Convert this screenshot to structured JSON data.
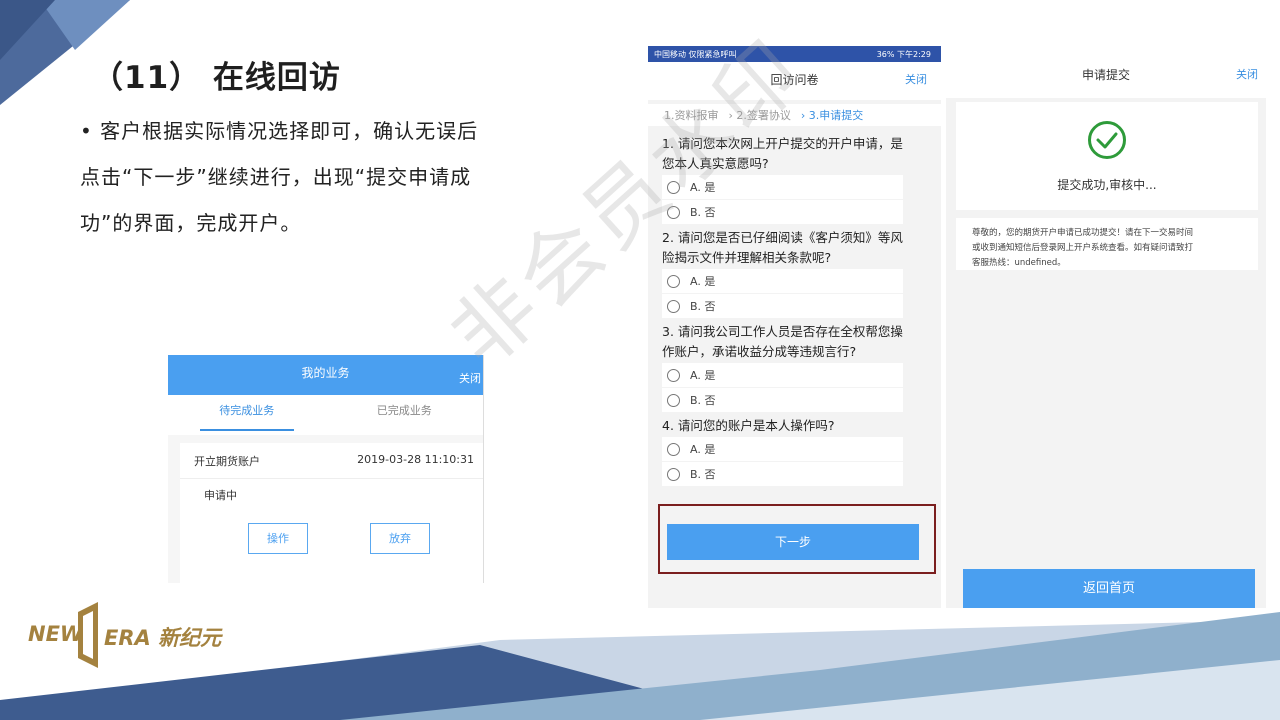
{
  "slide": {
    "title": "（11） 在线回访",
    "bullet_lines": [
      "• 客户根据实际情况选择即可，确认无误后",
      "点击“下一步”继续进行，出现“提交申请成",
      "功”的界面，完成开户。"
    ]
  },
  "logo": {
    "left": "NEW",
    "right": "ERA 新纪元"
  },
  "watermark": "非会员水印",
  "my_business": {
    "title": "我的业务",
    "close": "关闭",
    "tabs": [
      "待完成业务",
      "已完成业务"
    ],
    "item_name": "开立期货账户",
    "item_time": "2019-03-28 11:10:31",
    "status": "申请中",
    "buttons": [
      "操作",
      "放弃"
    ]
  },
  "questionnaire": {
    "status_left": "中国移动 仅限紧急呼叫",
    "status_right": "36% 下午2:29",
    "title": "回访问卷",
    "close": "关闭",
    "steps": [
      "1.资料报审",
      "›  2.签署协议",
      "›  3.申请提交"
    ],
    "questions": [
      {
        "text_lines": [
          "1. 请问您本次网上开户提交的开户申请，是",
          "您本人真实意愿吗?"
        ],
        "options": [
          "A. 是",
          "B. 否"
        ]
      },
      {
        "text_lines": [
          "2. 请问您是否已仔细阅读《客户须知》等风",
          "险揭示文件并理解相关条款呢?"
        ],
        "options": [
          "A. 是",
          "B. 否"
        ]
      },
      {
        "text_lines": [
          "3. 请问我公司工作人员是否存在全权帮您操",
          "作账户，承诺收益分成等违规言行?"
        ],
        "options": [
          "A. 是",
          "B. 否"
        ]
      },
      {
        "text_lines": [
          "4. 请问您的账户是本人操作吗?"
        ],
        "options": [
          "A. 是",
          "B. 否"
        ]
      }
    ],
    "next_button": "下一步"
  },
  "submit": {
    "title": "申请提交",
    "close": "关闭",
    "message": "提交成功,审核中...",
    "note_lines": [
      "尊敬的，您的期货开户申请已成功提交！请在下一交易时间",
      "或收到通知短信后登录网上开户系统查看。如有疑问请致打",
      "客服热线：undefined。"
    ],
    "home_button": "返回首页"
  },
  "colors": {
    "accent": "#4a9ff0",
    "statusbar": "#2e53a8",
    "success": "#2e9b3a",
    "logo_gold": "#a4823f"
  }
}
